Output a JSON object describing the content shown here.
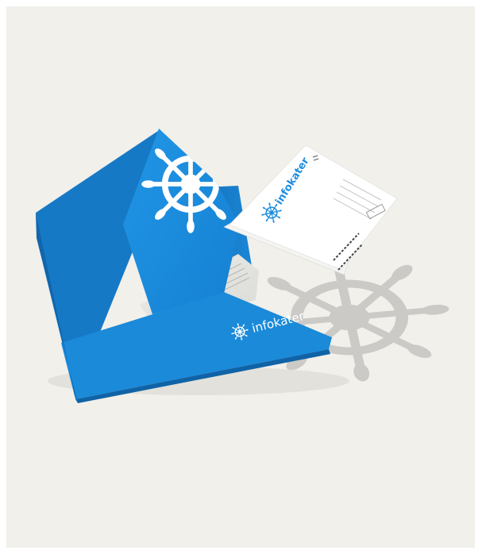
{
  "folder": {
    "brand_name": "infokater"
  },
  "envelope": {
    "brand_name": "infokater"
  },
  "colors": {
    "background": "#f2f0ea",
    "folder_blue": "#1d8ee0",
    "folder_blue_dark": "#1577c2",
    "folder_blue_edge": "#0f63a6",
    "envelope_white": "#ffffff",
    "shadow_gray": "#c9c8c4",
    "document_gray": "#e6e6e2"
  },
  "icons": [
    "ship-wheel-icon",
    "ship-wheel-shadow-icon"
  ]
}
